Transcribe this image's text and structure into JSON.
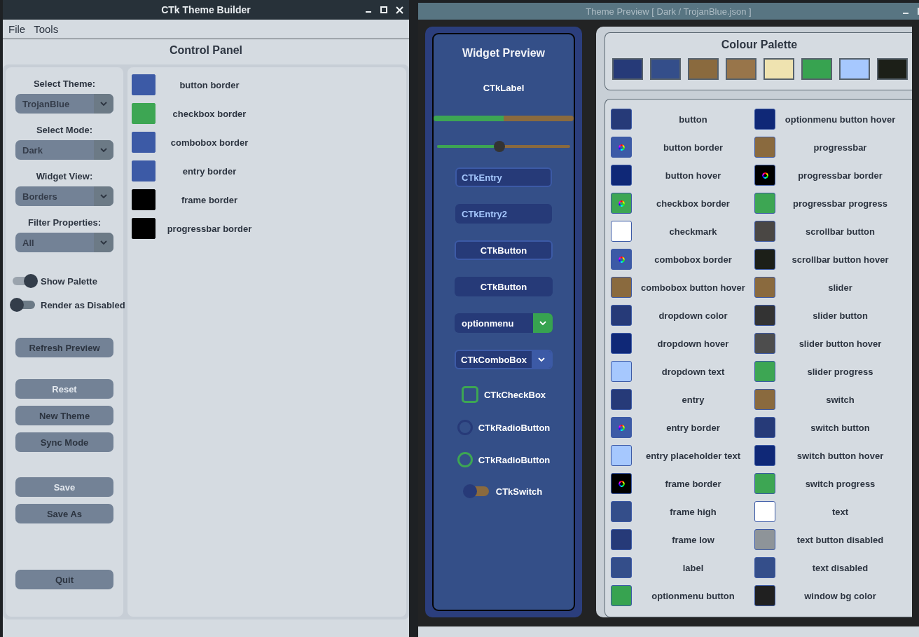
{
  "builder": {
    "title": "CTk Theme Builder",
    "menu": [
      "File",
      "Tools"
    ],
    "header": "Control Panel",
    "selects": [
      {
        "label": "Select Theme:",
        "value": "TrojanBlue"
      },
      {
        "label": "Select Mode:",
        "value": "Dark"
      },
      {
        "label": "Widget View:",
        "value": "Borders"
      },
      {
        "label": "Filter Properties:",
        "value": "All"
      }
    ],
    "switches": [
      {
        "label": "Show Palette",
        "on": true
      },
      {
        "label": "Render as Disabled",
        "on": false
      }
    ],
    "button_groups": [
      [
        {
          "label": "Refresh Preview",
          "disabled": false
        }
      ],
      [
        {
          "label": "Reset",
          "disabled": true
        },
        {
          "label": "New Theme",
          "disabled": false
        },
        {
          "label": "Sync Mode",
          "disabled": false
        }
      ],
      [
        {
          "label": "Save",
          "disabled": true
        },
        {
          "label": "Save As",
          "disabled": false
        }
      ],
      [
        {
          "label": "Quit",
          "disabled": false
        }
      ]
    ],
    "properties": [
      {
        "name": "button border",
        "color": "#3c5aa6"
      },
      {
        "name": "checkbox border",
        "color": "#3da653"
      },
      {
        "name": "combobox border",
        "color": "#3c5aa6"
      },
      {
        "name": "entry border",
        "color": "#3c5aa6"
      },
      {
        "name": "frame border",
        "color": "#000000"
      },
      {
        "name": "progressbar border",
        "color": "#000000"
      }
    ]
  },
  "preview": {
    "title": "Theme Preview [ Dark / TrojanBlue.json ]",
    "widget_preview": {
      "title": "Widget Preview",
      "widgets": [
        {
          "kind": "label",
          "text": "CTkLabel"
        },
        {
          "kind": "progressbar",
          "level": 0.5
        },
        {
          "kind": "slider",
          "level": 0.47
        },
        {
          "kind": "entry",
          "text": "CTkEntry",
          "bordered": true
        },
        {
          "kind": "entry",
          "text": "CTkEntry2",
          "bordered": false
        },
        {
          "kind": "button",
          "text": "CTkButton",
          "bordered": true
        },
        {
          "kind": "button",
          "text": "CTkButton",
          "bordered": false
        },
        {
          "kind": "optionmenu",
          "text": "optionmenu"
        },
        {
          "kind": "combobox",
          "text": "CTkComboBox"
        },
        {
          "kind": "checkbox",
          "text": "CTkCheckBox",
          "checked": false
        },
        {
          "kind": "radio",
          "text": "CTkRadioButton",
          "selected": false,
          "color": "#273a78"
        },
        {
          "kind": "radio",
          "text": "CTkRadioButton",
          "selected": false,
          "color": "#3da653"
        },
        {
          "kind": "switch",
          "text": "CTkSwitch",
          "on": false
        }
      ]
    },
    "palette": {
      "title": "Colour Palette",
      "colors": [
        {
          "color": "#263a78"
        },
        {
          "color": "#344e8a"
        },
        {
          "color": "#8a6a3e"
        },
        {
          "color": "#98754a"
        },
        {
          "color": "#efe3b0"
        },
        {
          "color": "#37a350"
        },
        {
          "color": "#a6c8fe"
        },
        {
          "color": "#1c1f18"
        }
      ]
    },
    "properties": [
      {
        "name": "button",
        "color": "#263a78",
        "picked": false
      },
      {
        "name": "button border",
        "color": "#3c5aa6",
        "picked": true
      },
      {
        "name": "button hover",
        "color": "#0f2877",
        "picked": false
      },
      {
        "name": "checkbox border",
        "color": "#3da653",
        "picked": true
      },
      {
        "name": "checkmark",
        "color": "#ffffff",
        "picked": false
      },
      {
        "name": "combobox border",
        "color": "#3c5aa6",
        "picked": true
      },
      {
        "name": "combobox button hover",
        "color": "#8a6a3e",
        "picked": false
      },
      {
        "name": "dropdown color",
        "color": "#263a78",
        "picked": false
      },
      {
        "name": "dropdown hover",
        "color": "#0f2877",
        "picked": false
      },
      {
        "name": "dropdown text",
        "color": "#a6c8fe",
        "picked": false
      },
      {
        "name": "entry",
        "color": "#263a78",
        "picked": false
      },
      {
        "name": "entry border",
        "color": "#3c5aa6",
        "picked": true
      },
      {
        "name": "entry placeholder text",
        "color": "#a6c8fe",
        "picked": false
      },
      {
        "name": "frame border",
        "color": "#000000",
        "picked": true
      },
      {
        "name": "frame high",
        "color": "#344e8a",
        "picked": false
      },
      {
        "name": "frame low",
        "color": "#263a78",
        "picked": false
      },
      {
        "name": "label",
        "color": "#344e8a",
        "picked": false
      },
      {
        "name": "optionmenu button",
        "color": "#37a350",
        "picked": false
      },
      {
        "name": "optionmenu button hover",
        "color": "#0f2877",
        "picked": false
      },
      {
        "name": "progressbar",
        "color": "#8a6a3e",
        "picked": false
      },
      {
        "name": "progressbar border",
        "color": "#000000",
        "picked": true
      },
      {
        "name": "progressbar progress",
        "color": "#3da653",
        "picked": false
      },
      {
        "name": "scrollbar button",
        "color": "#4a4744",
        "picked": false
      },
      {
        "name": "scrollbar button hover",
        "color": "#1c1f18",
        "picked": false
      },
      {
        "name": "slider",
        "color": "#8a6a3e",
        "picked": false
      },
      {
        "name": "slider button",
        "color": "#333333",
        "picked": false
      },
      {
        "name": "slider button hover",
        "color": "#4d4d4d",
        "picked": false
      },
      {
        "name": "slider progress",
        "color": "#3da653",
        "picked": false
      },
      {
        "name": "switch",
        "color": "#8a6a3e",
        "picked": false
      },
      {
        "name": "switch button",
        "color": "#263a78",
        "picked": false
      },
      {
        "name": "switch button hover",
        "color": "#0f2877",
        "picked": false
      },
      {
        "name": "switch progress",
        "color": "#3da653",
        "picked": false
      },
      {
        "name": "text",
        "color": "#ffffff",
        "picked": false
      },
      {
        "name": "text button disabled",
        "color": "#8e9499",
        "picked": false
      },
      {
        "name": "text disabled",
        "color": "#344e8a",
        "picked": false
      },
      {
        "name": "window bg color",
        "color": "#202020",
        "picked": false
      }
    ]
  }
}
